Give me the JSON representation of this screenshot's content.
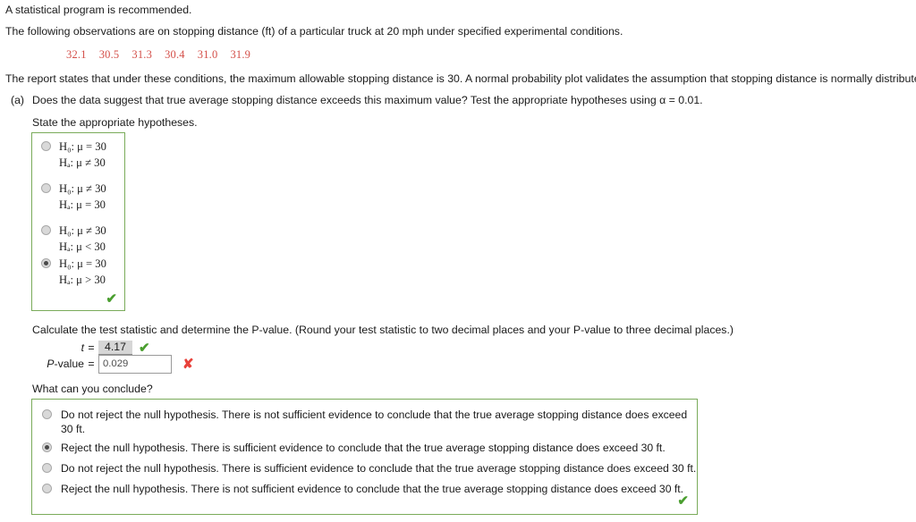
{
  "intro": {
    "line1": "A statistical program is recommended.",
    "line2": "The following observations are on stopping distance (ft) of a particular truck at 20 mph under specified experimental conditions.",
    "line3": "The report states that under these conditions, the maximum allowable stopping distance is 30. A normal probability plot validates the assumption that stopping distance is normally distributed."
  },
  "observations": [
    "32.1",
    "30.5",
    "31.3",
    "30.4",
    "31.0",
    "31.9"
  ],
  "part_a": {
    "label": "(a)",
    "question": "Does the data suggest that true average stopping distance exceeds this maximum value? Test the appropriate hypotheses using α = 0.01.",
    "prompt_hypotheses": "State the appropriate hypotheses."
  },
  "hypotheses": {
    "options": [
      {
        "null": "H₀: μ = 30",
        "alt": "Hₐ: μ ≠ 30",
        "selected": false
      },
      {
        "null": "H₀: μ ≠ 30",
        "alt": "Hₐ: μ = 30",
        "selected": false
      },
      {
        "null": "H₀: μ ≠ 30",
        "alt": "Hₐ: μ < 30",
        "selected": false
      },
      {
        "null": "H₀: μ = 30",
        "alt": "Hₐ: μ > 30",
        "selected": true
      }
    ],
    "feedback_icon": "check-mark",
    "feedback_symbol": "✔",
    "border_color": "#7aab5a"
  },
  "test_statistic": {
    "instruction": "Calculate the test statistic and determine the P-value. (Round your test statistic to two decimal places and your P-value to three decimal places.)",
    "t_label": "t",
    "t_equals": "=",
    "t_value": "4.17",
    "t_feedback_icon": "check-mark",
    "t_feedback_symbol": "✔",
    "p_label": "P-value",
    "p_equals": "=",
    "p_value": "0.029",
    "p_placeholder": "",
    "p_feedback_icon": "cross-mark",
    "p_feedback_symbol": "✘"
  },
  "conclusion": {
    "question": "What can you conclude?",
    "options": [
      {
        "text": "Do not reject the null hypothesis. There is not sufficient evidence to conclude that the true average stopping distance does exceed 30 ft.",
        "selected": false
      },
      {
        "text": "Reject the null hypothesis. There is sufficient evidence to conclude that the true average stopping distance does exceed 30 ft.",
        "selected": true
      },
      {
        "text": "Do not reject the null hypothesis. There is sufficient evidence to conclude that the true average stopping distance does exceed 30 ft.",
        "selected": false
      },
      {
        "text": "Reject the null hypothesis. There is not sufficient evidence to conclude that the true average stopping distance does exceed 30 ft.",
        "selected": false
      }
    ],
    "feedback_icon": "check-mark",
    "feedback_symbol": "✔",
    "border_color": "#7aab5a"
  },
  "colors": {
    "data_red": "#d4504a",
    "correct_green": "#4a9e2f",
    "incorrect_red": "#e8413a",
    "box_border_green": "#7aab5a"
  }
}
